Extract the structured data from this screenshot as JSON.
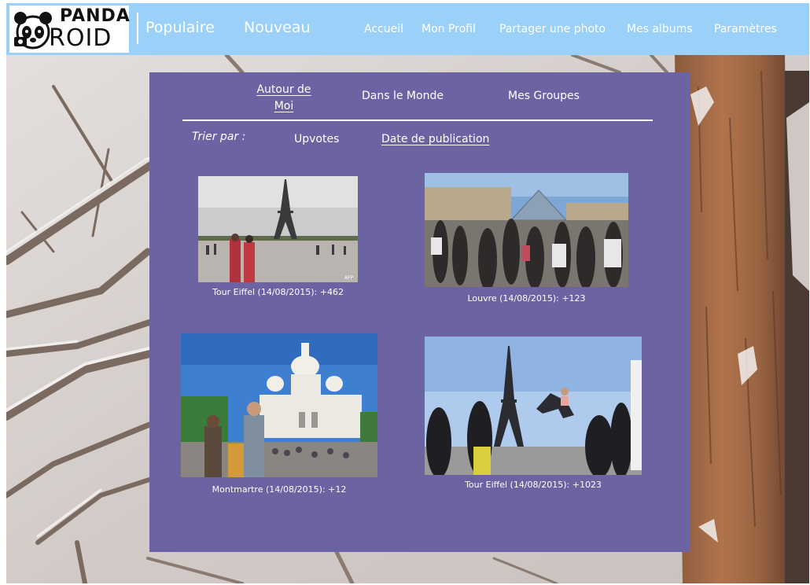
{
  "app": {
    "logo_top": "PANDA",
    "logo_bottom": "ROID"
  },
  "nav": {
    "popular": "Populaire",
    "new": "Nouveau",
    "home": "Accueil",
    "profile": "Mon Profil",
    "share": "Partager une photo",
    "albums": "Mes albums",
    "settings": "Paramètres"
  },
  "tabs": {
    "around_me_line1": "Autour de",
    "around_me_line2": "Moi",
    "world": "Dans le Monde",
    "groups": "Mes Groupes"
  },
  "sort": {
    "label": "Trier par :",
    "upvotes": "Upvotes",
    "date": "Date de publication"
  },
  "photos": [
    {
      "caption": "Tour Eiffel (14/08/2015): +462",
      "watermark": "AFP"
    },
    {
      "caption": "Louvre (14/08/2015): +123"
    },
    {
      "caption": "Montmartre (14/08/2015): +12"
    },
    {
      "caption": "Tour Eiffel (14/08/2015): +1023"
    }
  ],
  "colors": {
    "topbar": "#9bd0f8",
    "panel": "#6c64a2",
    "text": "#ffffff"
  }
}
